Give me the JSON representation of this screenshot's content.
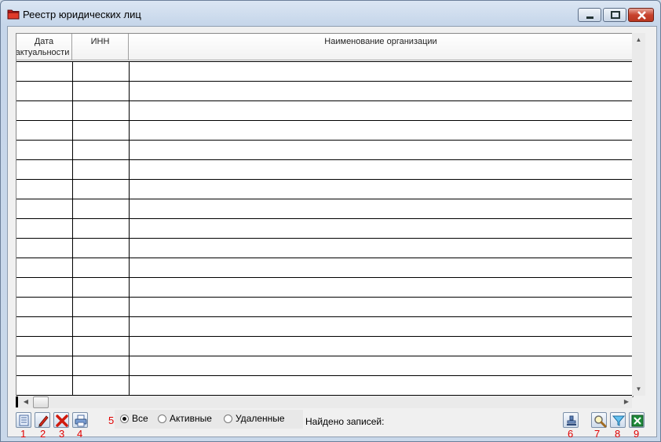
{
  "window": {
    "title": "Реестр юридических лиц",
    "controls": [
      "minimize",
      "maximize",
      "close"
    ]
  },
  "table": {
    "columns": [
      {
        "line1": "Дата",
        "line2": "актуальности"
      },
      {
        "line1": "ИНН",
        "line2": ""
      },
      {
        "line1": "Наименование организации",
        "line2": ""
      }
    ],
    "empty_rows": 17
  },
  "toolbar_left": [
    {
      "name": "add-button",
      "icon": "document-icon",
      "number": "1"
    },
    {
      "name": "edit-button",
      "icon": "pencil-icon",
      "number": "2"
    },
    {
      "name": "delete-button",
      "icon": "red-x-icon",
      "number": "3"
    },
    {
      "name": "print-button",
      "icon": "printer-icon",
      "number": "4"
    }
  ],
  "filter": {
    "number": "5",
    "options": [
      "Все",
      "Активные",
      "Удаленные"
    ],
    "selected": "Все"
  },
  "status": {
    "found_label": "Найдено записей:"
  },
  "toolbar_right": [
    {
      "name": "stamp-button",
      "icon": "stamp-icon",
      "number": "6"
    },
    {
      "name": "search-button",
      "icon": "magnifier-icon",
      "number": "7"
    },
    {
      "name": "filter-button",
      "icon": "funnel-icon",
      "number": "8"
    },
    {
      "name": "excel-export-button",
      "icon": "excel-icon",
      "number": "9"
    }
  ],
  "colors": {
    "annotation_numbers": "#e00000",
    "close_button": "#c8432e",
    "window_frame": "#c6d6ea"
  }
}
